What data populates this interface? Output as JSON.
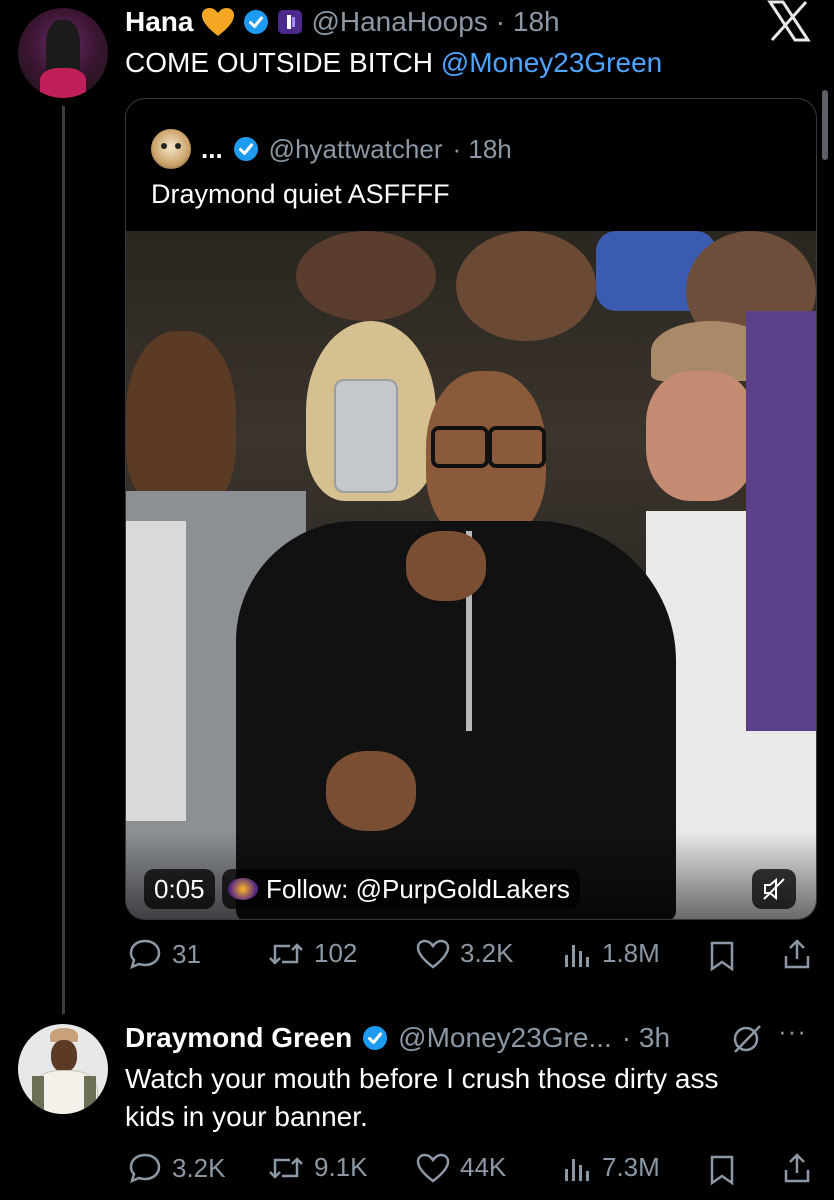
{
  "tweet1": {
    "name": "Hana",
    "handle": "@HanaHoops",
    "time": "· 18h",
    "text_main": "COME OUTSIDE BITCH ",
    "text_mention": "@Money23Green",
    "x_logo": "X"
  },
  "quote": {
    "name": "...",
    "handle": "@hyattwatcher",
    "time": "· 18h",
    "text": "Draymond quiet ASFFFF",
    "video_time": "0:05",
    "follow_text": "Follow: @PurpGoldLakers",
    "mute_icon": "muted-speaker-icon"
  },
  "tweet1_actions": {
    "replies": "31",
    "retweets": "102",
    "likes": "3.2K",
    "views": "1.8M"
  },
  "tweet2": {
    "name": "Draymond Green",
    "handle": "@Money23Gre...",
    "time": "· 3h",
    "more": "···",
    "text_line1": "Watch your mouth before I crush those dirty ass",
    "text_line2": "kids in your banner."
  },
  "tweet2_actions": {
    "replies": "3.2K",
    "retweets": "9.1K",
    "likes": "44K",
    "views": "7.3M"
  },
  "colors": {
    "background": "#000000",
    "text": "#e7e9ea",
    "muted": "#8b98a5",
    "link": "#4ea4ff",
    "verified": "#1d9bf0",
    "heart_emoji": "#f5a623"
  }
}
